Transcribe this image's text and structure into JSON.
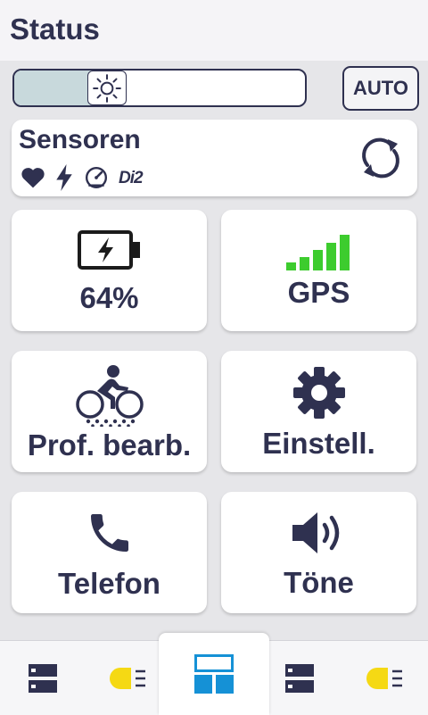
{
  "header": {
    "title": "Status"
  },
  "brightness": {
    "level": 0.29,
    "auto_label": "AUTO"
  },
  "sensors": {
    "title": "Sensoren",
    "icons": [
      "heart-icon",
      "bolt-icon",
      "speedometer-icon",
      "di2-icon"
    ],
    "di2_label": "Di2"
  },
  "tiles": [
    {
      "id": "battery",
      "icon": "battery-icon",
      "label": "64%"
    },
    {
      "id": "gps",
      "icon": "signal-bars-icon",
      "label": "GPS"
    },
    {
      "id": "profile",
      "icon": "cyclist-icon",
      "label": "Prof. bearb."
    },
    {
      "id": "settings",
      "icon": "gear-icon",
      "label": "Einstell."
    },
    {
      "id": "phone",
      "icon": "phone-icon",
      "label": "Telefon"
    },
    {
      "id": "sounds",
      "icon": "speaker-icon",
      "label": "Töne"
    }
  ],
  "colors": {
    "accent_blue": "#1591d6",
    "gps_green": "#3dcc2e",
    "light_yellow": "#f5d914",
    "text_dark": "#2f3150"
  },
  "tabbar": {
    "tabs": [
      "data-screen-icon",
      "headlight-icon",
      "status-grid-icon",
      "data-screen-icon",
      "headlight-icon"
    ],
    "active_index": 2
  }
}
